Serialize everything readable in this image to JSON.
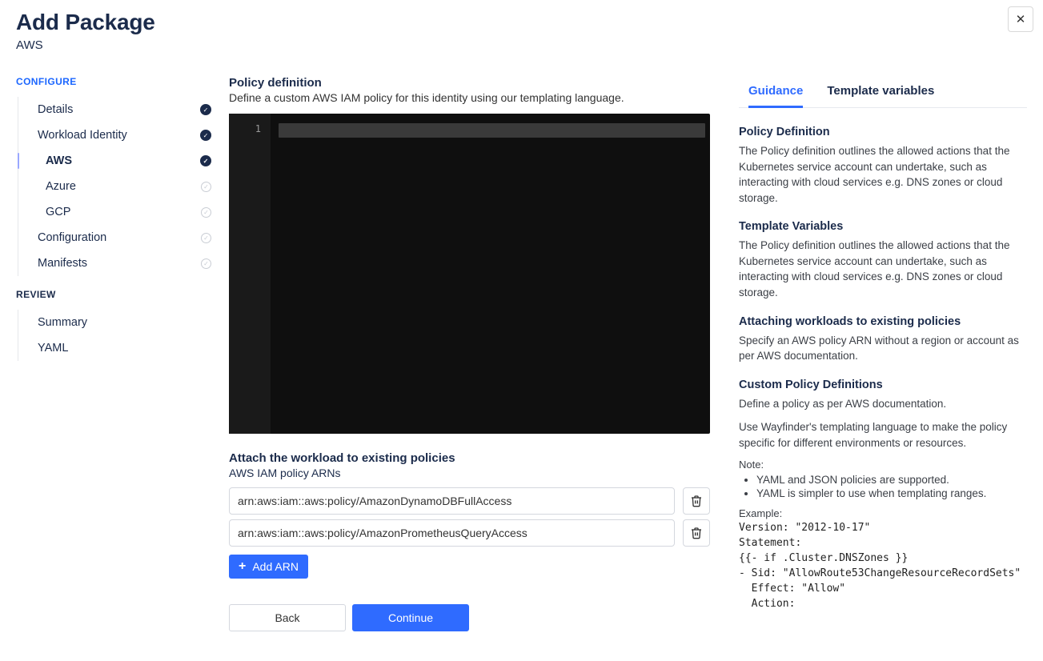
{
  "header": {
    "title": "Add Package",
    "subtitle": "AWS"
  },
  "close_label": "X",
  "sidebar": {
    "configure_label": "CONFIGURE",
    "review_label": "REVIEW",
    "items": [
      {
        "label": "Details"
      },
      {
        "label": "Workload Identity"
      },
      {
        "label": "AWS"
      },
      {
        "label": "Azure"
      },
      {
        "label": "GCP"
      },
      {
        "label": "Configuration"
      },
      {
        "label": "Manifests"
      }
    ],
    "review_items": [
      {
        "label": "Summary"
      },
      {
        "label": "YAML"
      }
    ]
  },
  "main": {
    "policy_title": "Policy definition",
    "policy_desc": "Define a custom AWS IAM policy for this identity using our templating language.",
    "gutter_line": "1",
    "attach_title": "Attach the workload to existing policies",
    "attach_desc": "AWS IAM policy ARNs",
    "arns": [
      "arn:aws:iam::aws:policy/AmazonDynamoDBFullAccess",
      "arn:aws:iam::aws:policy/AmazonPrometheusQueryAccess"
    ],
    "add_arn_label": "Add ARN",
    "back_label": "Back",
    "continue_label": "Continue"
  },
  "right": {
    "tabs": {
      "guidance": "Guidance",
      "template_vars": "Template variables"
    },
    "blocks": {
      "pd_h": "Policy Definition",
      "pd_p": "The Policy definition outlines the allowed actions that the Kubernetes service account can undertake, such as interacting with cloud services e.g. DNS zones or cloud storage.",
      "tv_h": "Template Variables",
      "tv_p": "The Policy definition outlines the allowed actions that the Kubernetes service account can undertake, such as interacting with cloud services e.g. DNS zones or cloud storage.",
      "aw_h": "Attaching workloads to existing policies",
      "aw_p": "Specify an AWS policy ARN without a region or account as per AWS documentation.",
      "cp_h": "Custom Policy Definitions",
      "cp_p1": "Define a policy as per AWS documentation.",
      "cp_p2": "Use Wayfinder's templating language to make the policy specific for different environments or resources.",
      "note_label": "Note:",
      "note_items": [
        "YAML and JSON policies are supported.",
        "YAML is simpler to use when templating ranges."
      ],
      "example_label": "Example:",
      "example_code": "Version: \"2012-10-17\"\nStatement:\n{{- if .Cluster.DNSZones }}\n- Sid: \"AllowRoute53ChangeResourceRecordSets\"\n  Effect: \"Allow\"\n  Action:"
    }
  }
}
